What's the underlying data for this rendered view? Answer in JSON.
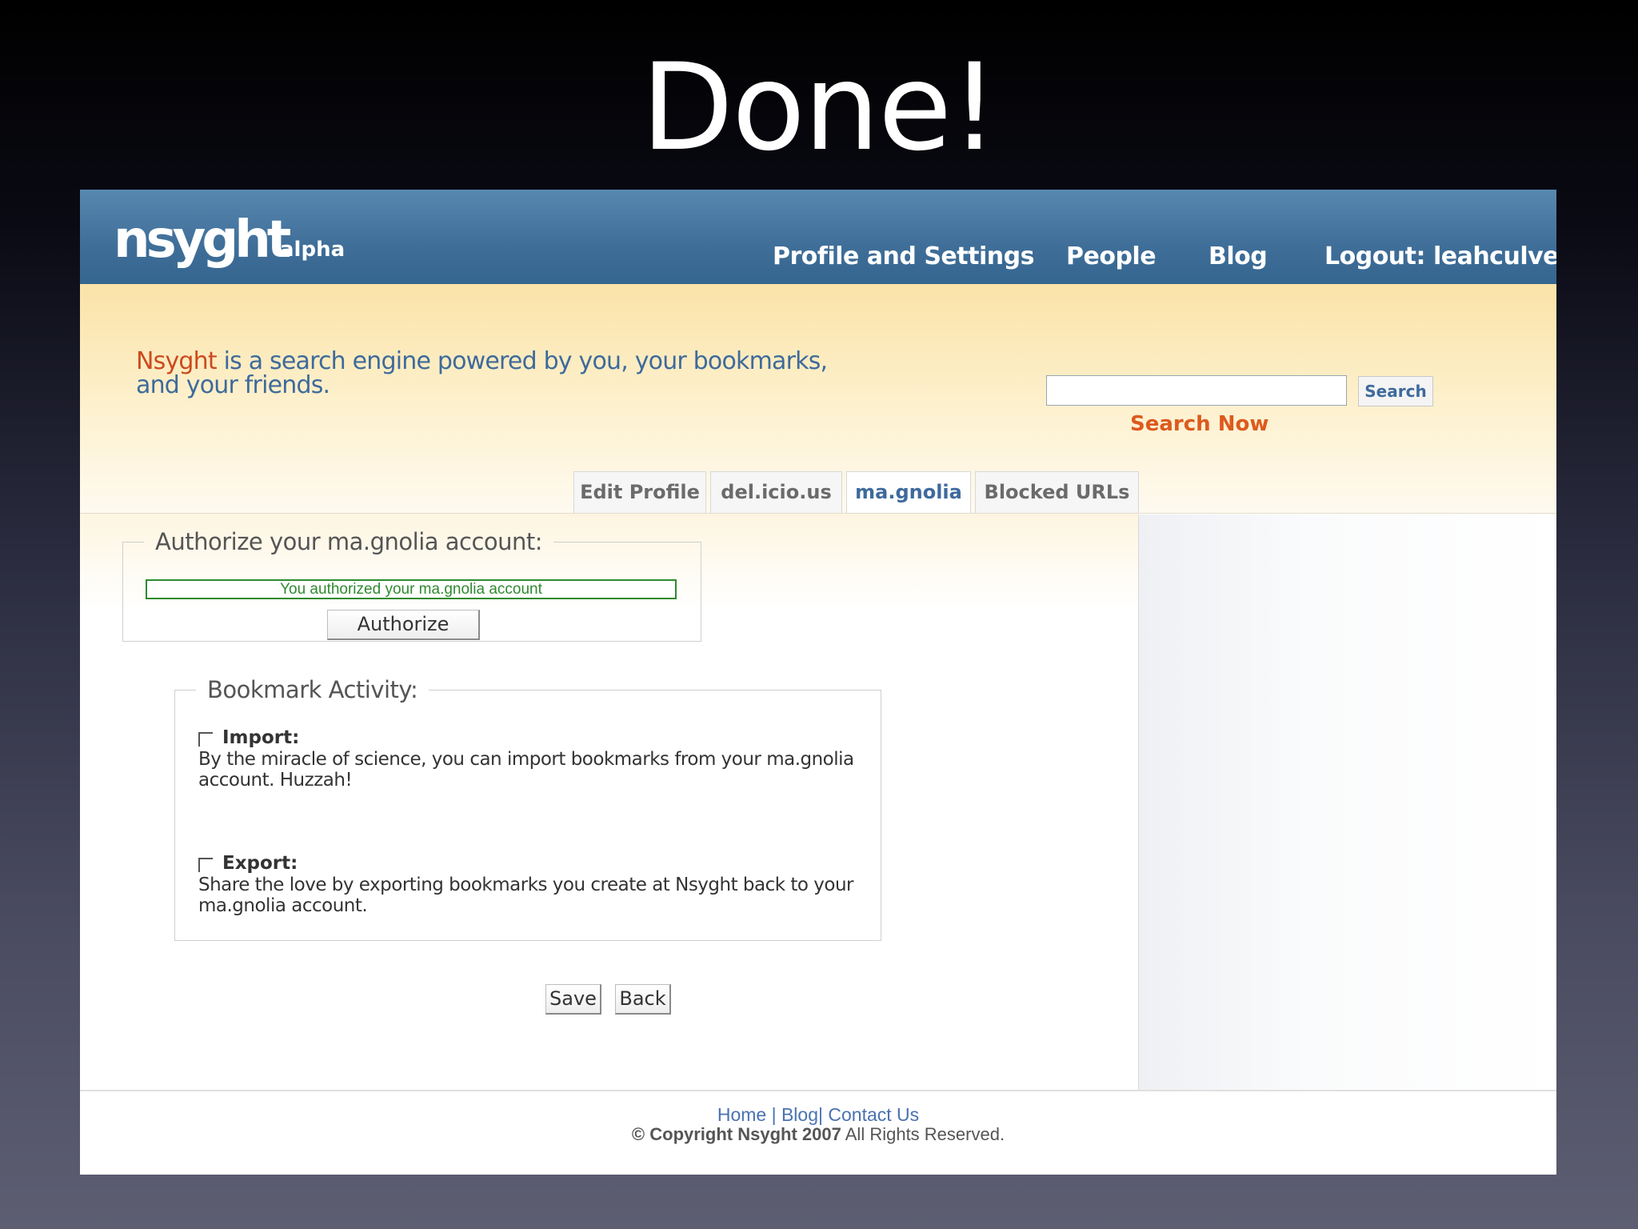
{
  "slide": {
    "title": "Done!"
  },
  "header": {
    "logo": "nsyght",
    "logo_tag": "alpha",
    "nav": [
      "Profile and Settings",
      "People",
      "Blog",
      "Logout: leahculver"
    ]
  },
  "banner": {
    "brand": "Nsyght",
    "tagline_rest": " is a search engine powered by you, your bookmarks, and your friends.",
    "search_placeholder": "",
    "search_button": "Search",
    "search_now": "Search Now"
  },
  "tabs": [
    {
      "label": "Edit Profile",
      "active": false
    },
    {
      "label": "del.icio.us",
      "active": false
    },
    {
      "label": "ma.gnolia",
      "active": true
    },
    {
      "label": "Blocked URLs",
      "active": false
    }
  ],
  "authorize": {
    "legend": "Authorize your ma.gnolia account:",
    "message": "You authorized your ma.gnolia account",
    "button": "Authorize"
  },
  "activity": {
    "legend": "Bookmark Activity:",
    "import": {
      "title": "Import:",
      "checked": false,
      "description": "By the miracle of science, you can import bookmarks from your ma.gnolia account. Huzzah!"
    },
    "export": {
      "title": "Export:",
      "checked": false,
      "description": "Share the love by exporting bookmarks you create at Nsyght back to your ma.gnolia account."
    }
  },
  "actions": {
    "save": "Save",
    "back": "Back"
  },
  "footer": {
    "links": [
      "Home",
      "Blog",
      "Contact Us"
    ],
    "separator": "|",
    "copyright_bold": "© Copyright Nsyght 2007",
    "copyright_rest": " All Rights Reserved."
  },
  "colors": {
    "header_blue": "#3f6e98",
    "brand_orange": "#cc4a1e",
    "link_blue": "#3e6a9c",
    "success_green": "#2f8a2f"
  }
}
